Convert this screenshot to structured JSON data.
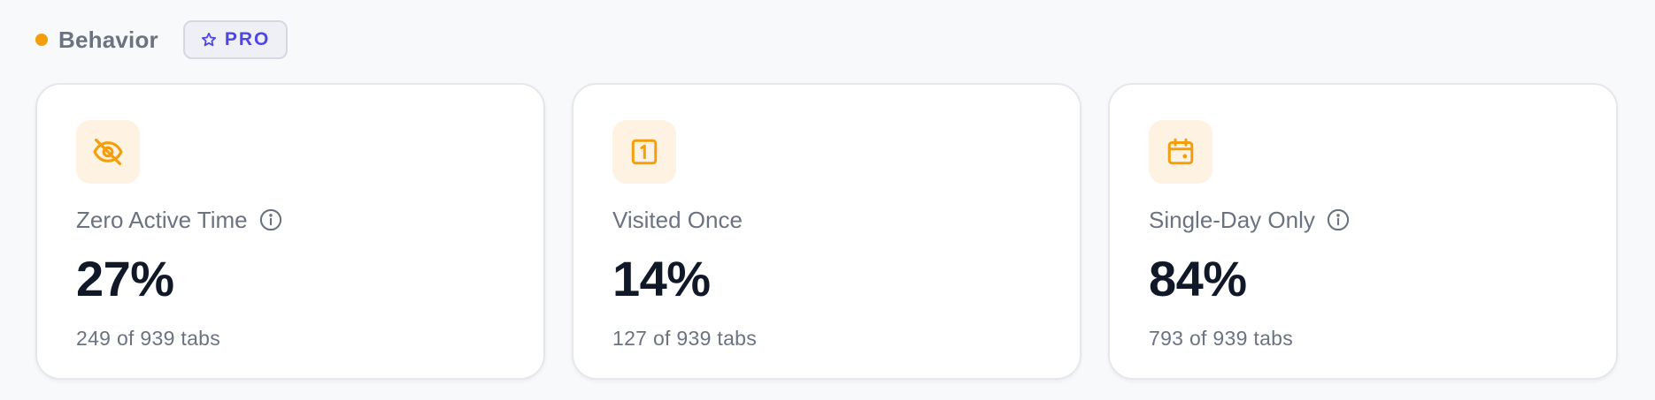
{
  "section": {
    "title": "Behavior",
    "dot_color": "#f59e0b",
    "badge": {
      "label": "PRO",
      "icon": "star-icon",
      "color": "#4f46e5"
    }
  },
  "cards": [
    {
      "icon": "eye-off-icon",
      "label": "Zero Active Time",
      "has_info": true,
      "value": "27%",
      "sub": "249 of 939 tabs"
    },
    {
      "icon": "number-one-square-icon",
      "label": "Visited Once",
      "has_info": false,
      "value": "14%",
      "sub": "127 of 939 tabs"
    },
    {
      "icon": "calendar-icon",
      "label": "Single-Day Only",
      "has_info": true,
      "value": "84%",
      "sub": "793 of 939 tabs"
    }
  ],
  "colors": {
    "accent": "#f59e0b",
    "icon_tile_bg": "#fef3e2",
    "value_text": "#111827",
    "muted_text": "#6b7280"
  }
}
